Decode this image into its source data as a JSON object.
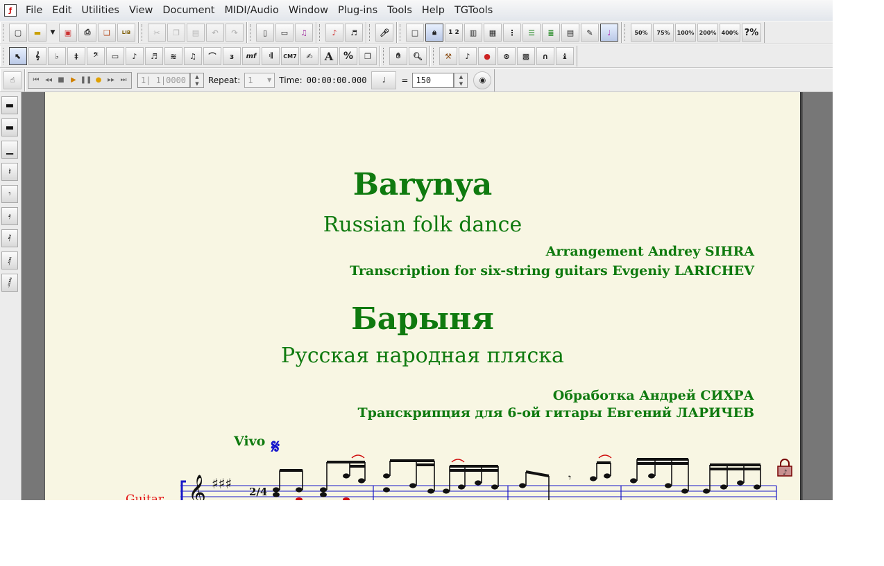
{
  "window": {
    "menu": [
      "File",
      "Edit",
      "Utilities",
      "View",
      "Document",
      "MIDI/Audio",
      "Window",
      "Plug-ins",
      "Tools",
      "Help",
      "TGTools"
    ]
  },
  "toolbar1": {
    "zoom_buttons": [
      "50%",
      "75%",
      "100%",
      "200%",
      "400%",
      "?%"
    ]
  },
  "toolbar2": {
    "chord_label": "CM7",
    "expression_label": "mf",
    "text_tool_label": "A",
    "percent_label": "%"
  },
  "playback": {
    "counter": "1| 1|0000",
    "repeat_label": "Repeat:",
    "repeat_value": "1",
    "time_label": "Time:",
    "time_value": "00:00:00.000",
    "equals": "=",
    "tempo_value": "150"
  },
  "score": {
    "title_en": "Barynya",
    "subtitle_en": "Russian folk dance",
    "credit_arrangement_en": "Arrangement Andrey SIHRA",
    "credit_transcription_en": "Transcription for six-string guitars Evgeniy LARICHEV",
    "title_ru": "Барыня",
    "subtitle_ru": "Русская народная пляска",
    "credit_arrangement_ru": "Обработка Андрей СИХРА",
    "credit_transcription_ru": "Транскрипция для 6-ой гитары Евгений ЛАРИЧЕВ",
    "tempo_marking": "Vivo",
    "segno": "𝄋",
    "instrument": "Guitar",
    "time_signature": "2/4"
  },
  "colors": {
    "text_green": "#0f7a0f",
    "segno_blue": "#1515cc",
    "instrument_red": "#e31010",
    "paper": "#f8f6e3"
  }
}
